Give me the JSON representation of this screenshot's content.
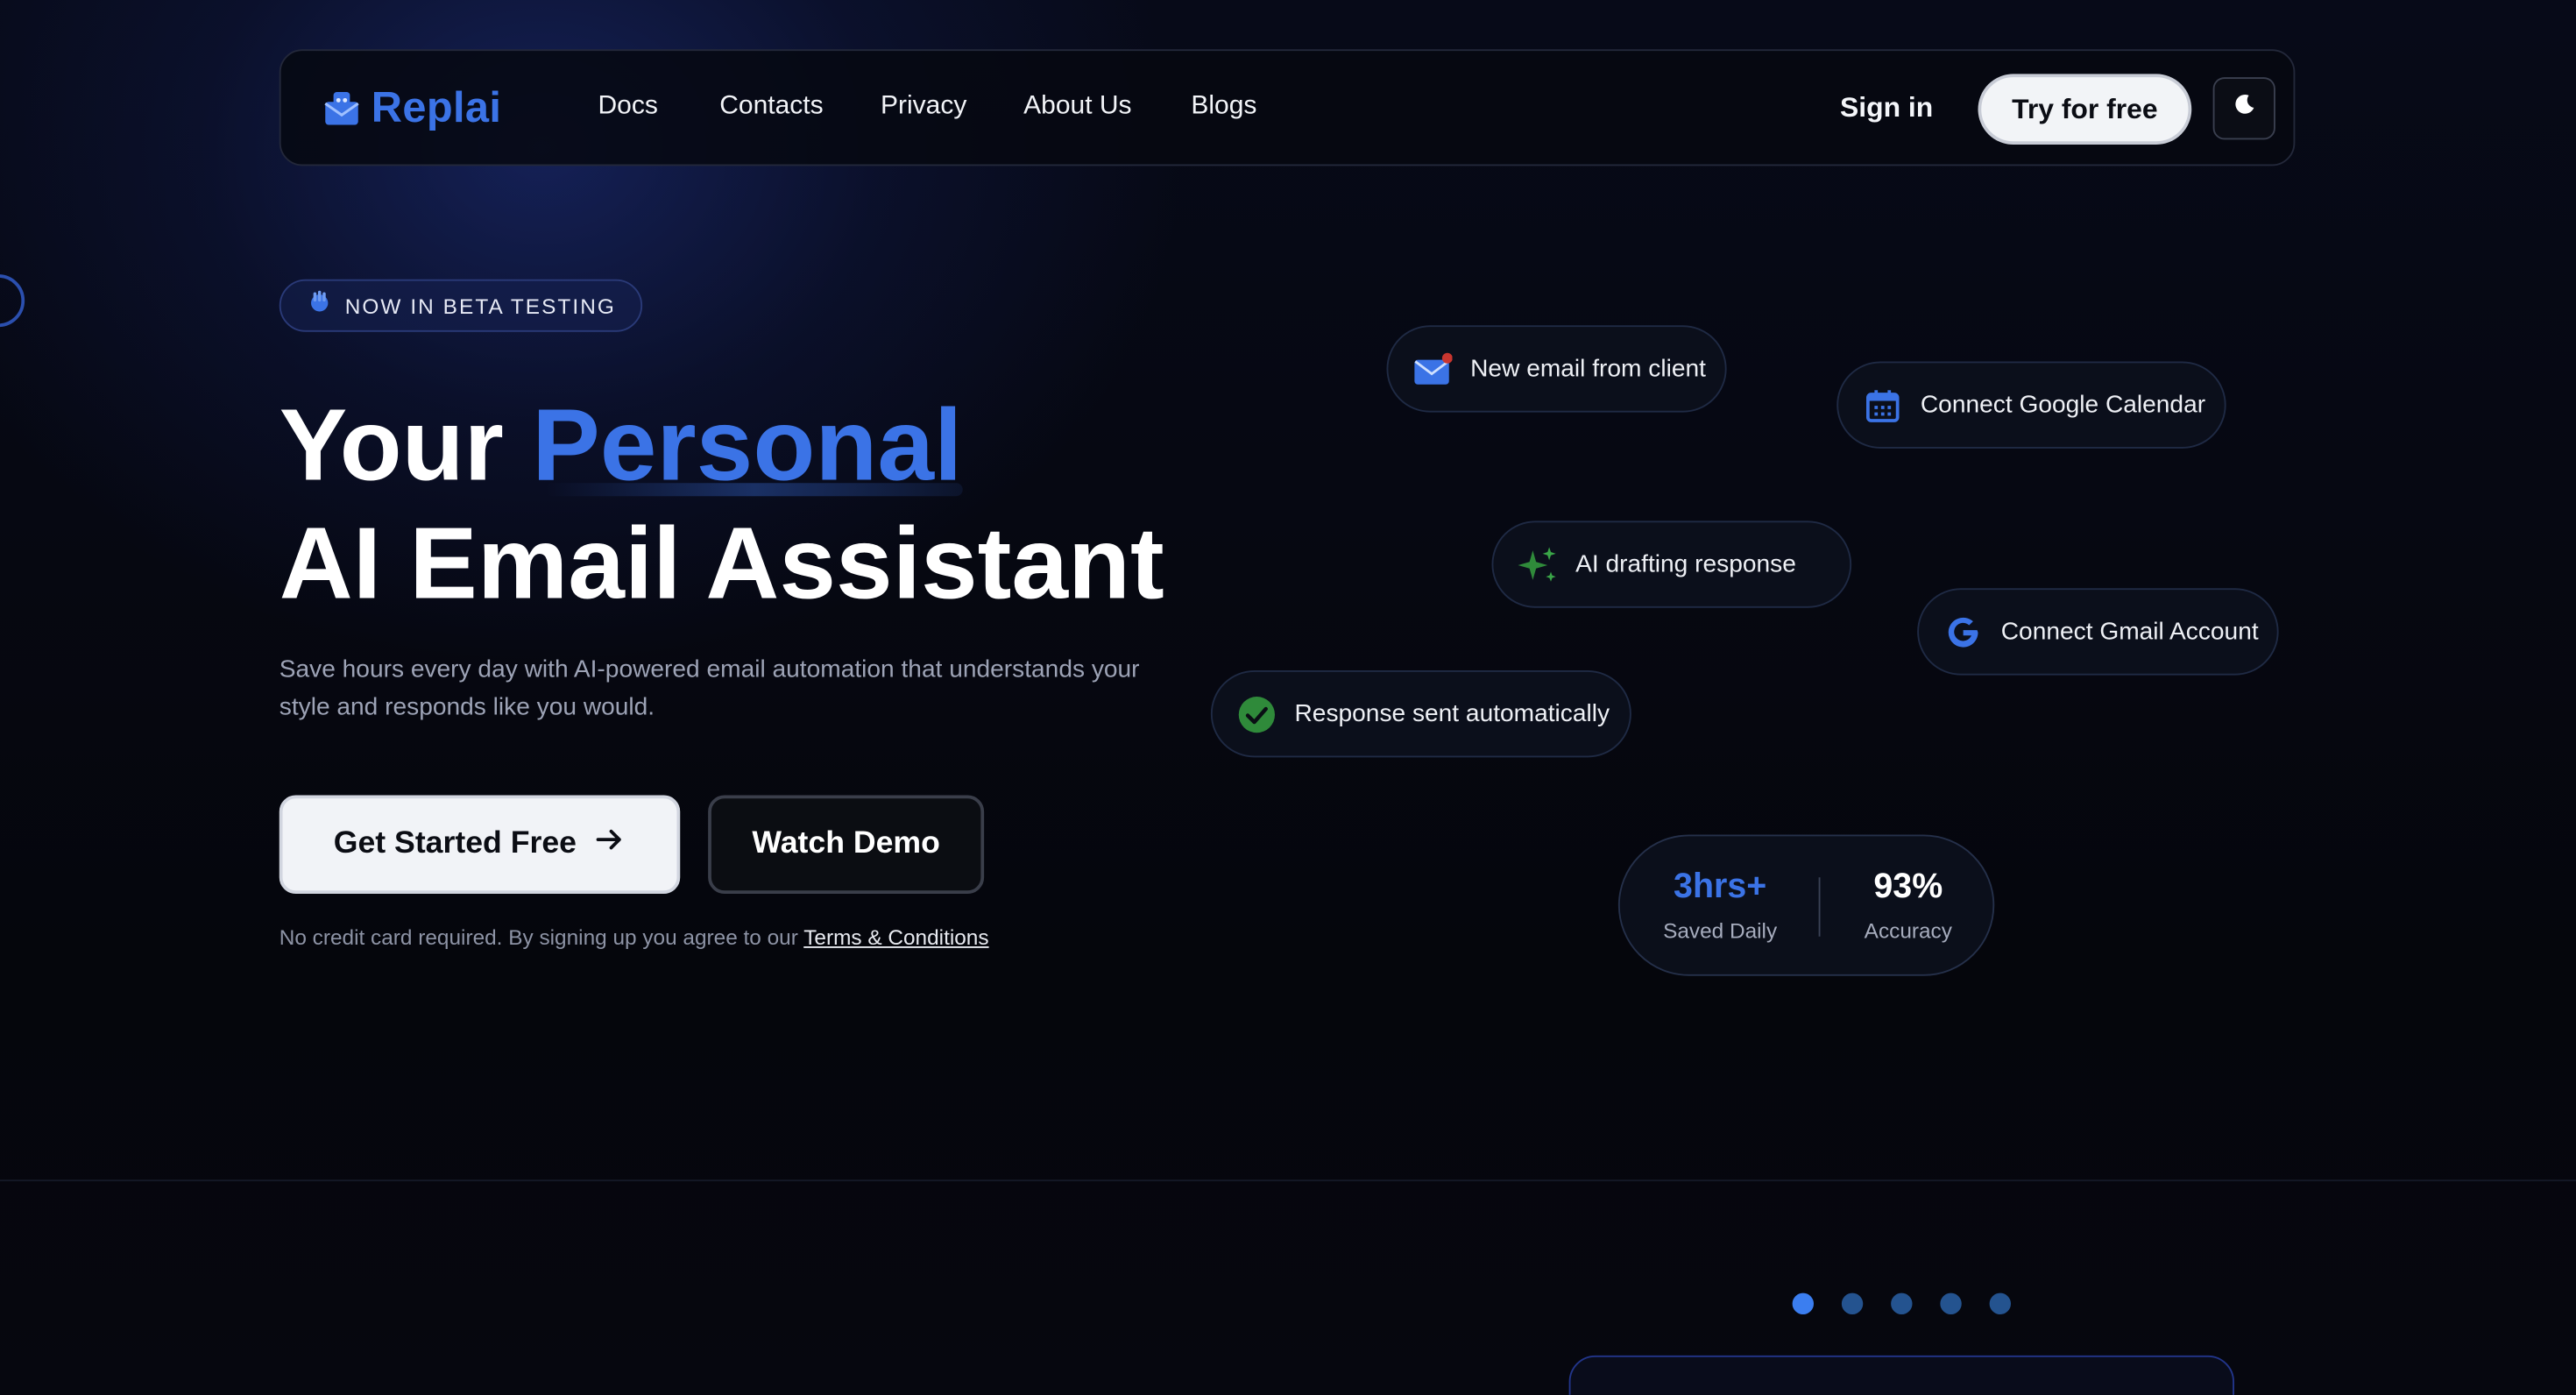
{
  "brand": {
    "name": "Replai",
    "accent_color": "#3b73e6"
  },
  "nav": {
    "links": [
      "Docs",
      "Contacts",
      "Privacy",
      "About Us",
      "Blogs"
    ],
    "sign_in": "Sign in",
    "cta": "Try for free",
    "theme_toggle_icon": "moon-icon"
  },
  "hero": {
    "badge": "NOW IN BETA TESTING",
    "headline_prefix": "Your",
    "headline_accent": "Personal",
    "headline_line2": "AI Email Assistant",
    "subtext": "Save hours every day with AI-powered email automation that understands your style and responds like you would.",
    "primary_button": "Get Started Free",
    "secondary_button": "Watch Demo",
    "disclaimer": "No credit card required. By signing up you agree to our",
    "terms_link": "Terms & Conditions"
  },
  "cards": {
    "new_email": "New email from client",
    "calendar": "Connect Google Calendar",
    "drafting": "AI drafting response",
    "gmail": "Connect Gmail Account",
    "sent": "Response sent automatically"
  },
  "stats": [
    {
      "value": "3hrs+",
      "label": "Saved Daily"
    },
    {
      "value": "93%",
      "label": "Accuracy"
    }
  ],
  "carousel": {
    "count": 5,
    "active_index": 0
  }
}
